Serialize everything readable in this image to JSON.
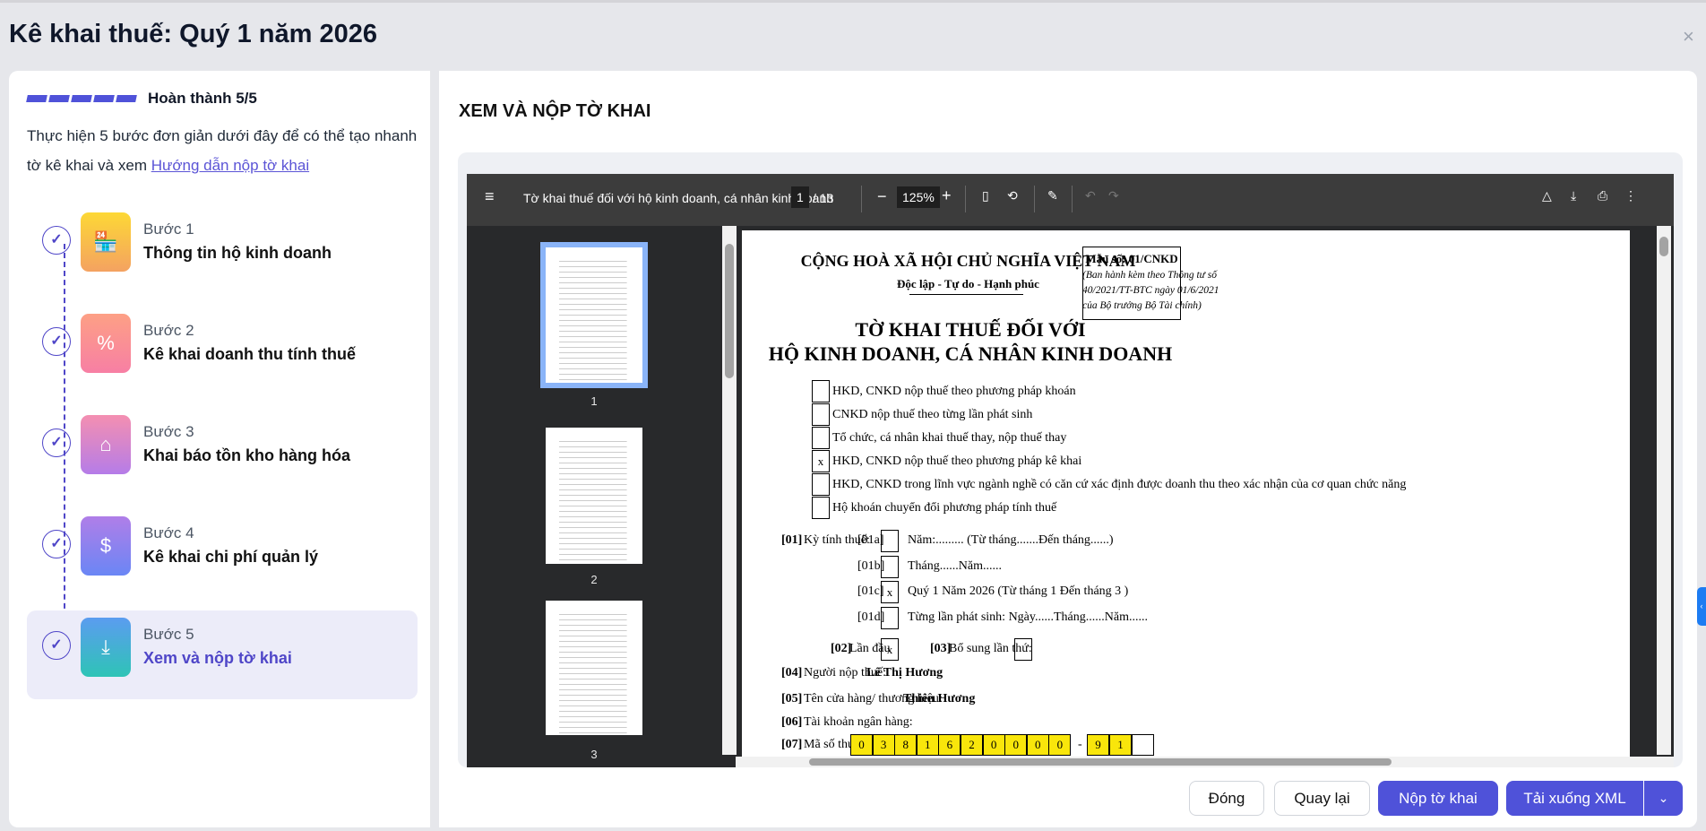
{
  "header": {
    "title": "Kê khai thuế: Quý 1 năm 2026",
    "close": "×"
  },
  "sidebar": {
    "progress": {
      "completed": 5,
      "total": 5,
      "label": "Hoàn thành 5/5"
    },
    "description": "Thực hiện 5 bước đơn giản dưới đây để có thể tạo nhanh tờ kê khai và xem ",
    "guide_link": "Hướng dẫn nộp tờ khai",
    "steps": [
      {
        "num": "Bước 1",
        "title": "Thông tin hộ kinh doanh",
        "icon": "store-icon",
        "glyph": "🏪"
      },
      {
        "num": "Bước 2",
        "title": "Kê khai doanh thu tính thuế",
        "icon": "percent-file-icon",
        "glyph": "%"
      },
      {
        "num": "Bước 3",
        "title": "Khai báo tồn kho hàng hóa",
        "icon": "warehouse-icon",
        "glyph": "⌂"
      },
      {
        "num": "Bước 4",
        "title": "Kê khai chi phí quản lý",
        "icon": "clipboard-dollar-icon",
        "glyph": "$"
      },
      {
        "num": "Bước 5",
        "title": "Xem và nộp tờ khai",
        "icon": "file-download-icon",
        "glyph": "⤓"
      }
    ],
    "check": "✓"
  },
  "main": {
    "section_title": "XEM VÀ NỘP TỜ KHAI",
    "viewer": {
      "doc_title": "Tờ khai thuế đối với hộ kinh doanh, cá nhân kinh doanh",
      "page": "1",
      "pages": "/ 13",
      "zoom": "125%",
      "thumb_labels": [
        "1",
        "2",
        "3"
      ]
    },
    "doc": {
      "header1": "CỘNG HOÀ XÃ HỘI CHỦ NGHĨA VIỆT NAM",
      "header2": "Độc lập - Tự do - Hạnh phúc",
      "form_no": "Mẫu số: 01/CNKD",
      "form_note": [
        "(Ban hành kèm theo Thông tư số",
        "40/2021/TT-BTC ngày 01/6/2021",
        "của Bộ trưởng Bộ Tài chính)"
      ],
      "title1": "TỜ KHAI THUẾ ĐỐI VỚI",
      "title2": "HỘ KINH DOANH, CÁ NHÂN KINH DOANH",
      "options": [
        {
          "mark": "",
          "text": "HKD, CNKD nộp thuế theo phương pháp khoán"
        },
        {
          "mark": "",
          "text": "CNKD nộp thuế theo từng lần phát sinh"
        },
        {
          "mark": "",
          "text": "Tổ chức, cá nhân khai thuế thay, nộp thuế thay"
        },
        {
          "mark": "x",
          "text": "HKD, CNKD nộp thuế theo phương pháp kê khai"
        },
        {
          "mark": "",
          "text": "HKD, CNKD trong lĩnh vực ngành nghề có căn cứ xác định được doanh thu theo xác nhận của cơ quan chức năng"
        },
        {
          "mark": "",
          "text": "Hộ khoán chuyển đổi phương pháp tính thuế"
        }
      ],
      "f01": "[01]",
      "f01_label": "Kỳ tính thuế:",
      "periods": [
        {
          "code": "[01a]",
          "mark": "",
          "text": "Năm:......... (Từ tháng.......Đến tháng......)"
        },
        {
          "code": "[01b]",
          "mark": "",
          "text": "Tháng......Năm......"
        },
        {
          "code": "[01c]",
          "mark": "x",
          "text": "Quý 1 Năm 2026 (Từ tháng 1 Đến tháng 3 )"
        },
        {
          "code": "[01d]",
          "mark": "",
          "text": "Từng lần phát sinh: Ngày......Tháng......Năm......"
        }
      ],
      "f02": "[02]",
      "f02_label": "Lần đầu",
      "f02_mark": "x",
      "f03": "[03]",
      "f03_label": "Bổ sung lần thứ:",
      "f04": "[04]",
      "f04_label": "Người nộp thuế:",
      "f04_value": "Lê Thị Hương",
      "f05": "[05]",
      "f05_label": "Tên cửa hàng/ thương hiệu:",
      "f05_value": "Thiên Hương",
      "f06": "[06]",
      "f06_label": "Tài khoản ngân hàng:",
      "f07": "[07]",
      "f07_label": "Mã số thuế:",
      "tax_id": [
        "0",
        "3",
        "8",
        "1",
        "6",
        "2",
        "0",
        "0",
        "0",
        "0"
      ],
      "dash": "-",
      "tax_suffix": [
        "9",
        "1",
        ""
      ]
    }
  },
  "footer": {
    "close": "Đóng",
    "back": "Quay lại",
    "submit": "Nộp tờ khai",
    "download": "Tải xuống XML",
    "more": "⌄"
  },
  "colors": {
    "primary": "#4f52d9",
    "highlight": "#f9e60b"
  }
}
